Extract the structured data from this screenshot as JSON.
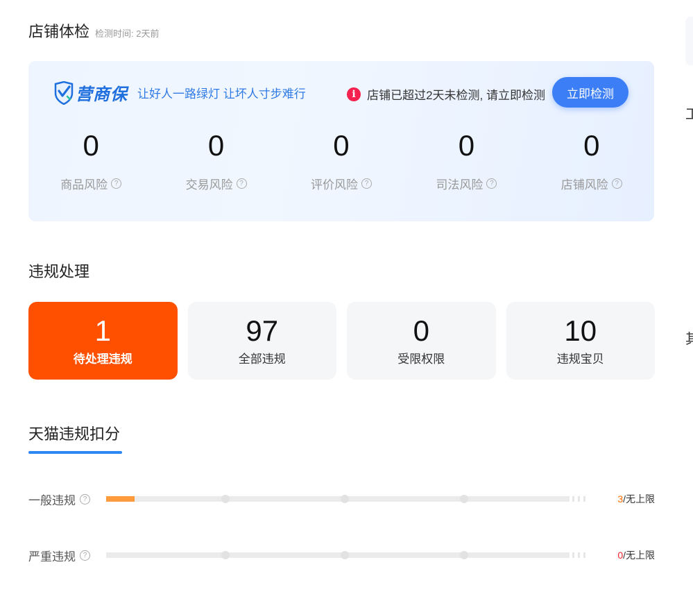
{
  "header": {
    "title": "店铺体检",
    "subtitle": "检测时间: 2天前"
  },
  "health": {
    "brand_name": "营商保",
    "slogan": "让好人一路绿灯 让坏人寸步难行",
    "warning": "店铺已超过2天未检测, 请立即检测",
    "check_button": "立即检测",
    "accent": "#3b7ef5",
    "metrics": [
      {
        "value": "0",
        "label": "商品风险"
      },
      {
        "value": "0",
        "label": "交易风险"
      },
      {
        "value": "0",
        "label": "评价风险"
      },
      {
        "value": "0",
        "label": "司法风险"
      },
      {
        "value": "0",
        "label": "店铺风险"
      }
    ]
  },
  "violations": {
    "title": "违规处理",
    "active_color": "#ff5000",
    "cards": [
      {
        "value": "1",
        "label": "待处理违规"
      },
      {
        "value": "97",
        "label": "全部违规"
      },
      {
        "value": "0",
        "label": "受限权限"
      },
      {
        "value": "10",
        "label": "违规宝贝"
      }
    ]
  },
  "tmall": {
    "title": "天猫违规扣分",
    "rows": [
      {
        "label": "一般违规",
        "current": "3",
        "limit": "/无上限",
        "progress": 0.06
      },
      {
        "label": "严重违规",
        "current": "0",
        "limit": "/无上限",
        "progress": 0
      }
    ]
  },
  "side": {
    "glyph_1": "工",
    "glyph_2": "其"
  }
}
